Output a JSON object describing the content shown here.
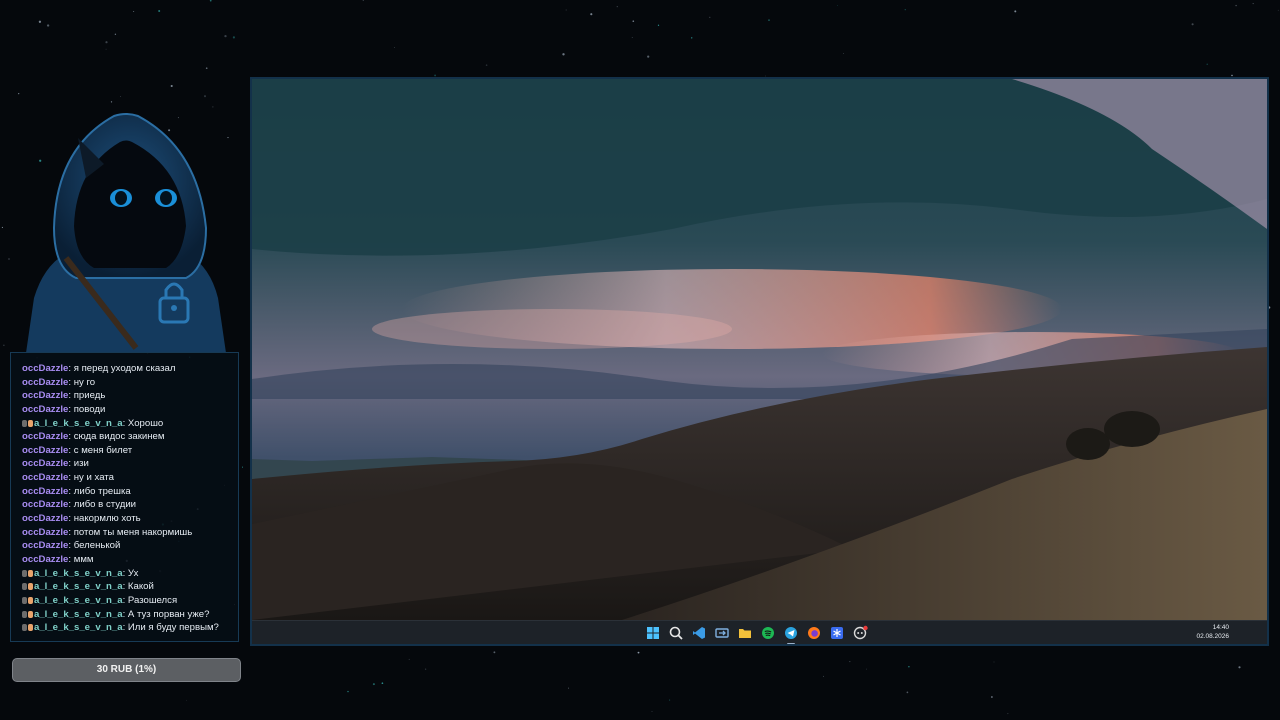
{
  "colors": {
    "username_occ": "#a98df2",
    "username_alek": "#7fd0c8",
    "message_text": "#e6ecf3",
    "panel_border": "#173a55",
    "donation_bar_bg": "#5c5f63",
    "taskbar_bg": "#1d2228"
  },
  "chat": {
    "messages": [
      {
        "user": "occDazzle",
        "text": "я перед уходом сказал",
        "badge": false
      },
      {
        "user": "occDazzle",
        "text": "ну го",
        "badge": false
      },
      {
        "user": "occDazzle",
        "text": "приедь",
        "badge": false
      },
      {
        "user": "occDazzle",
        "text": "поводи",
        "badge": false
      },
      {
        "user": "a_l_e_k_s_e_v_n_a",
        "text": "Хорошо",
        "badge": true
      },
      {
        "user": "occDazzle",
        "text": "сюда видос закинем",
        "badge": false
      },
      {
        "user": "occDazzle",
        "text": "с меня билет",
        "badge": false
      },
      {
        "user": "occDazzle",
        "text": "изи",
        "badge": false
      },
      {
        "user": "occDazzle",
        "text": "ну и хата",
        "badge": false
      },
      {
        "user": "occDazzle",
        "text": "либо трешка",
        "badge": false
      },
      {
        "user": "occDazzle",
        "text": "либо в студии",
        "badge": false
      },
      {
        "user": "occDazzle",
        "text": "накормлю хоть",
        "badge": false
      },
      {
        "user": "occDazzle",
        "text": "потом ты меня накормишь",
        "badge": false
      },
      {
        "user": "occDazzle",
        "text": "беленькой",
        "badge": false
      },
      {
        "user": "occDazzle",
        "text": "ммм",
        "badge": false
      },
      {
        "user": "a_l_e_k_s_e_v_n_a",
        "text": "Ух",
        "badge": true
      },
      {
        "user": "a_l_e_k_s_e_v_n_a",
        "text": "Какой",
        "badge": true
      },
      {
        "user": "a_l_e_k_s_e_v_n_a",
        "text": "Разошелся",
        "badge": true
      },
      {
        "user": "a_l_e_k_s_e_v_n_a",
        "text": "А туз порван уже?",
        "badge": true
      },
      {
        "user": "a_l_e_k_s_e_v_n_a",
        "text": "Или я буду первым?",
        "badge": true
      }
    ]
  },
  "donation": {
    "label": "30 RUB (1%)",
    "progress_fraction": 0.01
  },
  "taskbar": {
    "time": "14:40",
    "date": "02.08.2026",
    "icons": [
      {
        "name": "windows-start-icon",
        "active": false
      },
      {
        "name": "search-icon",
        "active": false
      },
      {
        "name": "vscode-icon",
        "active": false
      },
      {
        "name": "remote-desktop-icon",
        "active": false
      },
      {
        "name": "file-explorer-icon",
        "active": false
      },
      {
        "name": "spotify-icon",
        "active": false
      },
      {
        "name": "telegram-icon",
        "active": true
      },
      {
        "name": "firefox-icon",
        "active": false
      },
      {
        "name": "snowflake-app-icon",
        "active": false
      },
      {
        "name": "discord-icon",
        "active": false,
        "notification": true
      }
    ]
  }
}
